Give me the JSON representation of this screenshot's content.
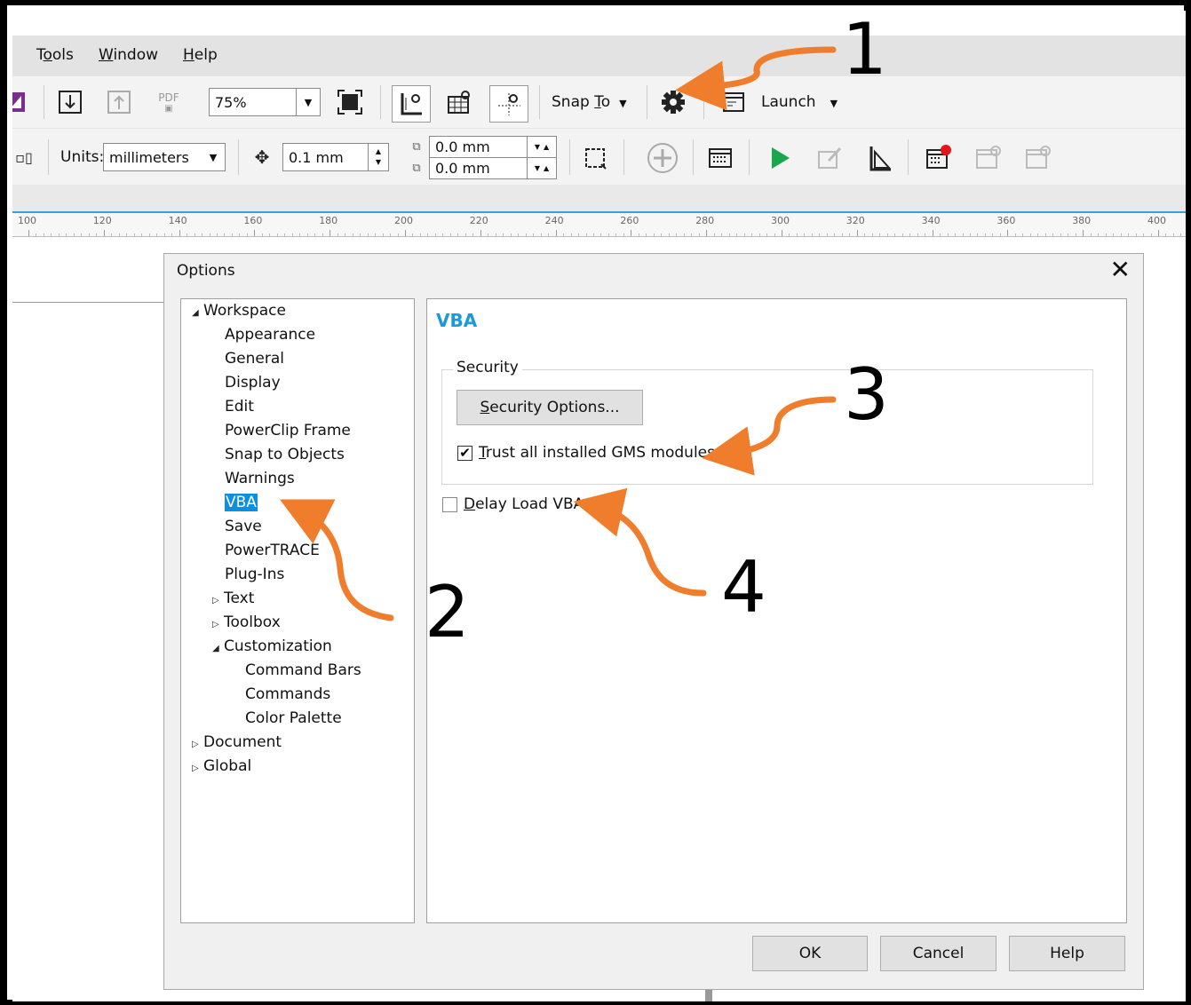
{
  "menu": {
    "items": [
      {
        "label": "Tools",
        "ul": "o",
        "pre": "T",
        "post": "ols"
      },
      {
        "label": "Window",
        "ul": "W",
        "pre": "",
        "post": "indow"
      },
      {
        "label": "Help",
        "ul": "H",
        "pre": "",
        "post": "elp"
      }
    ]
  },
  "toolbar1": {
    "pdf_label": "PDF",
    "zoom_value": "75%",
    "snap_to": {
      "pre": "Snap ",
      "ul": "T",
      "post": "o"
    },
    "launch_label": "Launch"
  },
  "toolbar2": {
    "units_label": "Units:",
    "units_value": "millimeters",
    "nudge_value": "0.1 mm",
    "dup_x": "0.0 mm",
    "dup_y": "0.0 mm"
  },
  "ruler": {
    "labels": [
      "100",
      "120",
      "140",
      "160",
      "180",
      "200",
      "220",
      "240",
      "260",
      "280",
      "300",
      "320",
      "340",
      "360",
      "380",
      "400"
    ]
  },
  "dialog": {
    "title": "Options",
    "close_glyph": "✕",
    "tree": {
      "workspace": "Workspace",
      "appearance": "Appearance",
      "general": "General",
      "display": "Display",
      "edit": "Edit",
      "powerclip": "PowerClip Frame",
      "snap": "Snap to Objects",
      "warnings": "Warnings",
      "vba": "VBA",
      "save": "Save",
      "powertrace": "PowerTRACE",
      "plugins": "Plug-Ins",
      "text": "Text",
      "toolbox": "Toolbox",
      "customization": "Customization",
      "command_bars": "Command Bars",
      "commands": "Commands",
      "color_palette": "Color Palette",
      "document": "Document",
      "global": "Global"
    },
    "panel": {
      "title": "VBA",
      "security_group": "Security",
      "security_button": {
        "ul": "S",
        "post": "ecurity Options..."
      },
      "trust_checkbox": {
        "ul": "T",
        "post": "rust all installed GMS modules",
        "checked": true
      },
      "delay_checkbox": {
        "ul": "D",
        "post": "elay Load VBA",
        "checked": false
      }
    },
    "buttons": {
      "ok": "OK",
      "cancel": "Cancel",
      "help": "Help"
    }
  },
  "annotations": {
    "n1": "1",
    "n2": "2",
    "n3": "3",
    "n4": "4",
    "arrow_color": "#f07d2b"
  }
}
